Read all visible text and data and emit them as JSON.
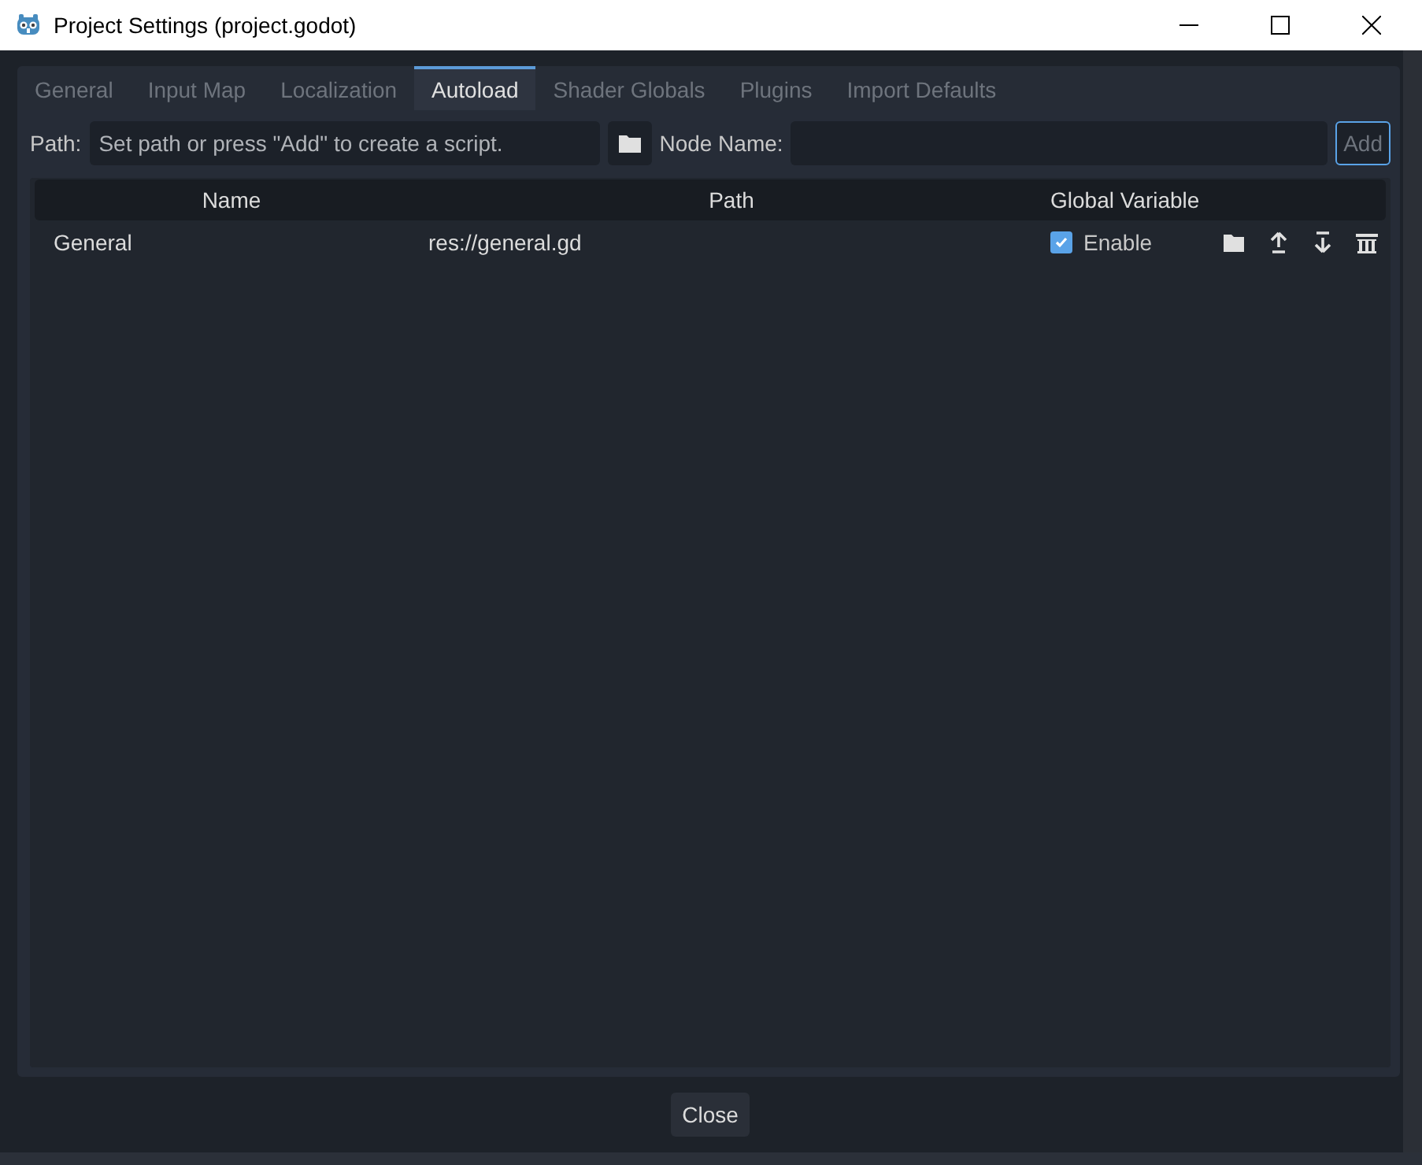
{
  "window": {
    "title": "Project Settings (project.godot)"
  },
  "tabs": [
    {
      "label": "General",
      "selected": false
    },
    {
      "label": "Input Map",
      "selected": false
    },
    {
      "label": "Localization",
      "selected": false
    },
    {
      "label": "Autoload",
      "selected": true
    },
    {
      "label": "Shader Globals",
      "selected": false
    },
    {
      "label": "Plugins",
      "selected": false
    },
    {
      "label": "Import Defaults",
      "selected": false
    }
  ],
  "toolbar": {
    "path_label": "Path:",
    "path_placeholder": "Set path or press \"Add\" to create a script.",
    "node_name_label": "Node Name:",
    "add_button": "Add"
  },
  "table": {
    "columns": [
      "Name",
      "Path",
      "Global Variable"
    ],
    "rows": [
      {
        "name": "General",
        "path": "res://general.gd",
        "enabled": true,
        "enable_label": "Enable"
      }
    ]
  },
  "buttons": {
    "close": "Close"
  }
}
